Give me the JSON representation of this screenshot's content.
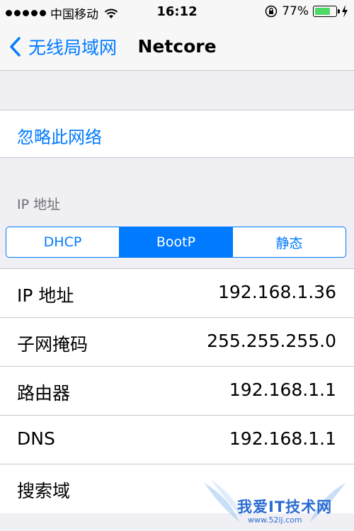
{
  "status_bar": {
    "carrier": "中国移动",
    "time": "16:12",
    "battery_percent": "77%",
    "battery_level": 0.77,
    "battery_color": "#4cd964",
    "icons": [
      "signal-dots",
      "wifi-icon",
      "rotation-lock-icon",
      "battery-icon",
      "charging-bolt-icon"
    ]
  },
  "nav": {
    "back_label": "无线局域网",
    "title": "Netcore",
    "accent": "#007aff"
  },
  "forget_network": {
    "label": "忽略此网络"
  },
  "ip_section": {
    "header": "IP 地址",
    "segments": [
      {
        "label": "DHCP",
        "selected": false
      },
      {
        "label": "BootP",
        "selected": true
      },
      {
        "label": "静态",
        "selected": false
      }
    ],
    "rows": [
      {
        "label": "IP 地址",
        "value": "192.168.1.36"
      },
      {
        "label": "子网掩码",
        "value": "255.255.255.0"
      },
      {
        "label": "路由器",
        "value": "192.168.1.1"
      },
      {
        "label": "DNS",
        "value": "192.168.1.1"
      },
      {
        "label": "搜索域",
        "value": ""
      }
    ]
  },
  "watermark": {
    "text": "我爱IT技术网",
    "url": "www.52ij.com"
  }
}
